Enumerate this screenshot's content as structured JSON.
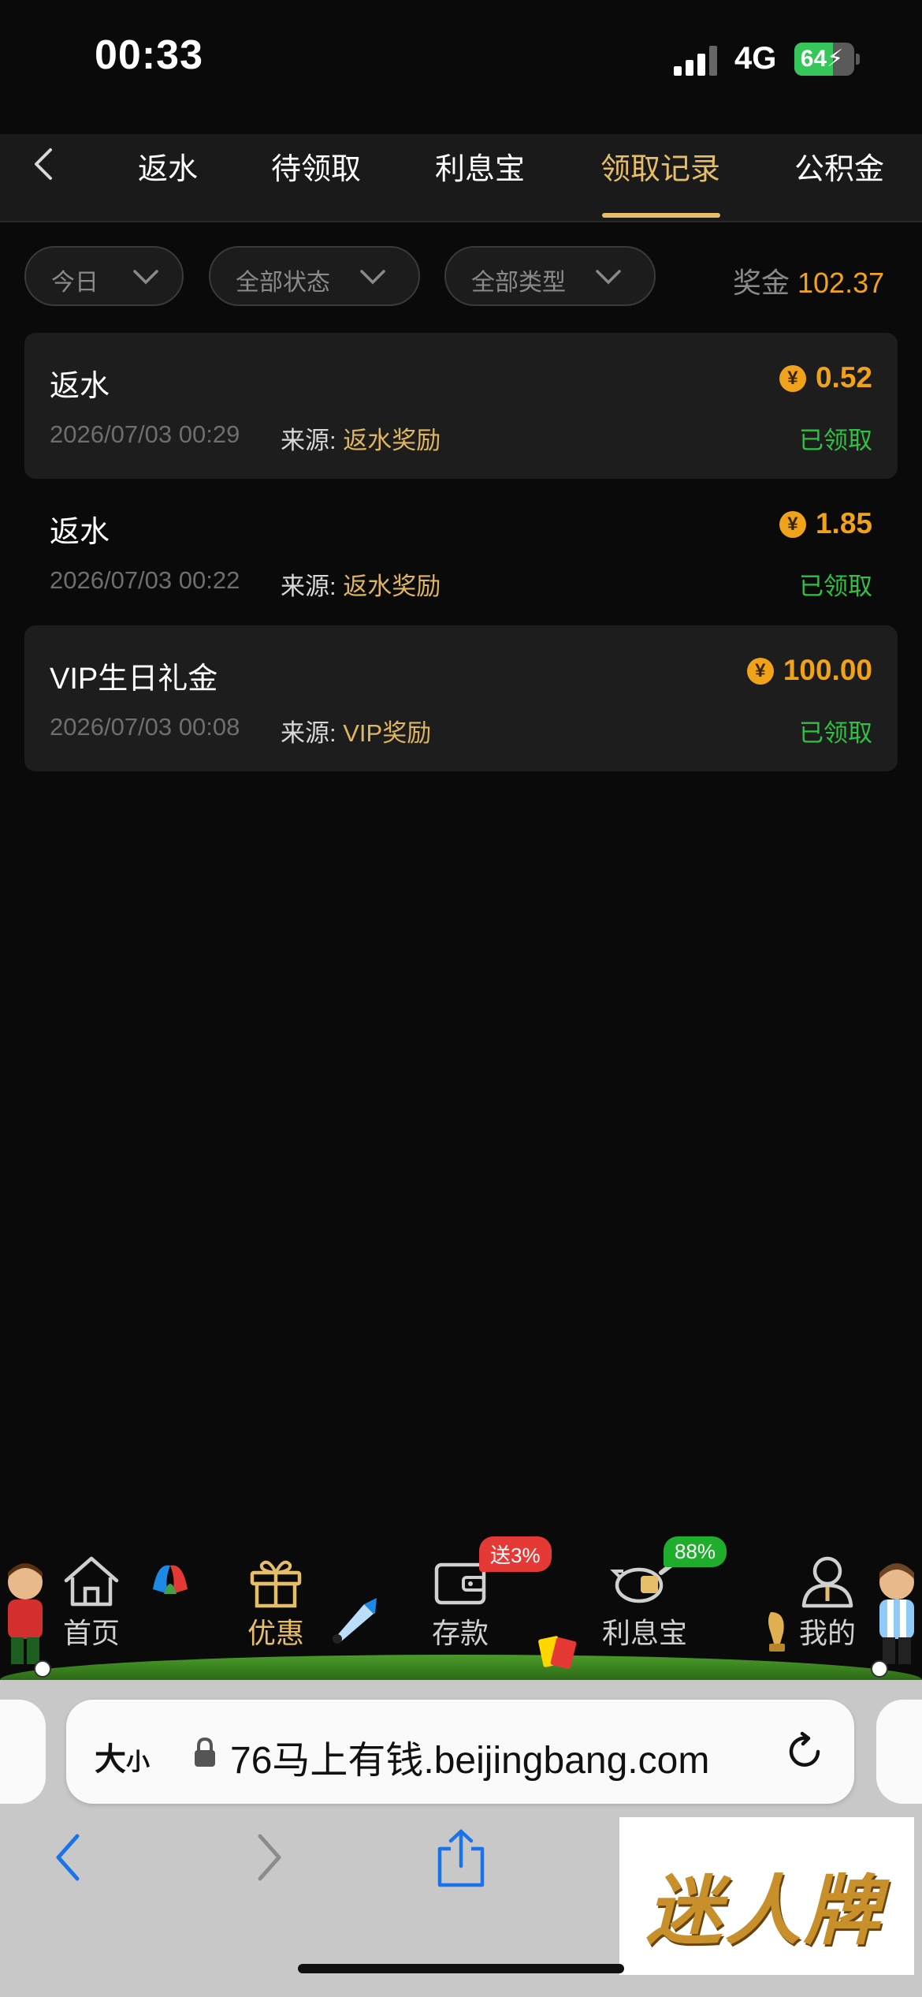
{
  "status_bar": {
    "time": "00:33",
    "network": "4G",
    "battery": "64"
  },
  "tabs": [
    {
      "label": "返水",
      "active": false
    },
    {
      "label": "待领取",
      "active": false
    },
    {
      "label": "利息宝",
      "active": false
    },
    {
      "label": "领取记录",
      "active": true
    },
    {
      "label": "公积金",
      "active": false
    }
  ],
  "filters": {
    "date": "今日",
    "status": "全部状态",
    "type": "全部类型",
    "bonus_label": "奖金",
    "bonus_value": "102.37"
  },
  "records": [
    {
      "title": "返水",
      "time": "2026/07/03 00:29",
      "source_label": "来源:",
      "source": "返水奖励",
      "currency_symbol": "¥",
      "amount": "0.52",
      "status": "已领取"
    },
    {
      "title": "返水",
      "time": "2026/07/03 00:22",
      "source_label": "来源:",
      "source": "返水奖励",
      "currency_symbol": "¥",
      "amount": "1.85",
      "status": "已领取"
    },
    {
      "title": "VIP生日礼金",
      "time": "2026/07/03 00:08",
      "source_label": "来源:",
      "source": "VIP奖励",
      "currency_symbol": "¥",
      "amount": "100.00",
      "status": "已领取"
    }
  ],
  "bottom_nav": [
    {
      "label": "首页",
      "icon": "home-icon",
      "active": false
    },
    {
      "label": "优惠",
      "icon": "gift-icon",
      "active": true
    },
    {
      "label": "存款",
      "icon": "wallet-icon",
      "active": false,
      "badge": "送3%"
    },
    {
      "label": "利息宝",
      "icon": "piggy-bank-icon",
      "active": false,
      "badge": "88%"
    },
    {
      "label": "我的",
      "icon": "user-icon",
      "active": false
    }
  ],
  "browser": {
    "text_size_label": "大",
    "text_size_small": "小",
    "url": "76马上有钱.beijingbang.com"
  },
  "watermark": "迷人牌",
  "colors": {
    "accent_gold": "#e6bd68",
    "amount_orange": "#f0a31a",
    "status_green": "#2fc242",
    "badge_red": "#e53935",
    "badge_green": "#1fae2c"
  }
}
